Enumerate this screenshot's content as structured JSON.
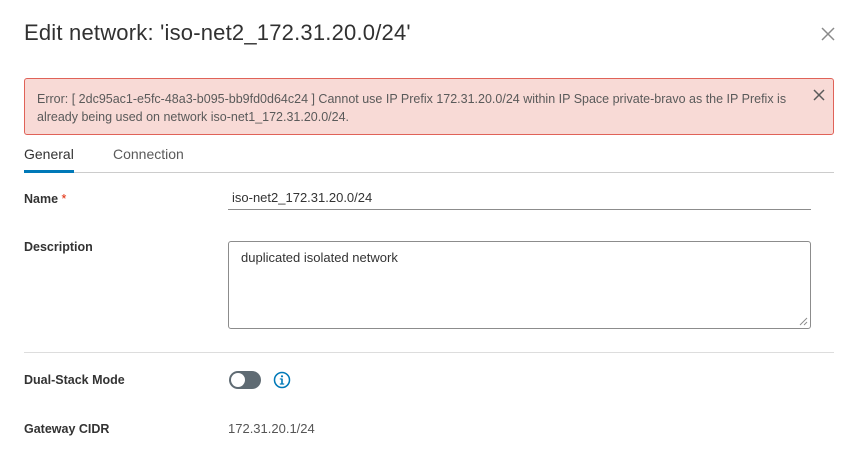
{
  "dialog": {
    "title": "Edit network: 'iso-net2_172.31.20.0/24'",
    "close_icon": "close-icon"
  },
  "alert": {
    "type": "error",
    "message": "Error: [ 2dc95ac1-e5fc-48a3-b095-bb9fd0d64c24 ] Cannot use IP Prefix 172.31.20.0/24 within IP Space private-bravo as the IP Prefix is already being used on network iso-net1_172.31.20.0/24.",
    "close_icon": "close-icon",
    "colors": {
      "background": "#f8dad6",
      "border": "#e06258"
    }
  },
  "tabs": [
    {
      "label": "General",
      "active": true
    },
    {
      "label": "Connection",
      "active": false
    }
  ],
  "form": {
    "name": {
      "label": "Name",
      "required_mark": "*",
      "value": "iso-net2_172.31.20.0/24"
    },
    "description": {
      "label": "Description",
      "value": "duplicated isolated network"
    },
    "dual_stack": {
      "label": "Dual-Stack Mode",
      "enabled": false,
      "info_icon": "info-icon"
    },
    "gateway_cidr": {
      "label": "Gateway CIDR",
      "value": "172.31.20.1/24"
    }
  },
  "colors": {
    "accent": "#0079b8",
    "required": "#e02200"
  }
}
